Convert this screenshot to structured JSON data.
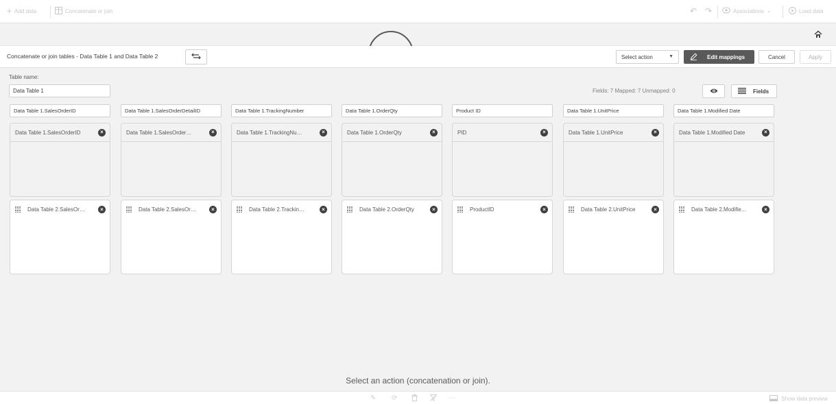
{
  "topbar": {
    "add_data": "Add data",
    "concatenate_or_join": "Concatenate or join",
    "associations": "Associations",
    "load_data": "Load data"
  },
  "toolbar": {
    "title": "Concatenate or join tables - Data Table 1 and Data Table 2",
    "select_action": "Select action",
    "edit_mappings": "Edit mappings",
    "cancel": "Cancel",
    "apply": "Apply"
  },
  "table_name": {
    "label": "Table name:",
    "value": "Data Table 1"
  },
  "fields_stats": "Fields: 7   Mapped: 7   Unmapped: 0",
  "fields_button": "Fields",
  "columns": [
    {
      "header": "Data Table 1.SalesOrderID",
      "table1_field": "Data Table 1.SalesOrderID",
      "table2_field": "Data Table 2.SalesOr…"
    },
    {
      "header": "Data Table 1.SalesOrderDetailID",
      "table1_field": "Data Table 1.SalesOrder…",
      "table2_field": "Data Table 2.SalesOr…"
    },
    {
      "header": "Data Table 1.TrackingNumber",
      "table1_field": "Data Table 1.TrackingNu…",
      "table2_field": "Data Table 2.Trackin…"
    },
    {
      "header": "Data Table 1.OrderQty",
      "table1_field": "Data Table 1.OrderQty",
      "table2_field": "Data Table 2.OrderQty"
    },
    {
      "header": "Product ID",
      "table1_field": "PID",
      "table2_field": "ProductID"
    },
    {
      "header": "Data Table 1.UnitPrice",
      "table1_field": "Data Table 1.UnitPrice",
      "table2_field": "Data Table 2.UnitPrice"
    },
    {
      "header": "Data Table 1.Modified Date",
      "table1_field": "Data Table 1.Modified Date",
      "table2_field": "Data Table 2.Modifie…"
    }
  ],
  "message": "Select an action (concatenation or join).",
  "bottom": {
    "show_preview": "Show data preview"
  },
  "colors": {
    "accent_dark": "#595959",
    "background": "#f2f2f2"
  }
}
